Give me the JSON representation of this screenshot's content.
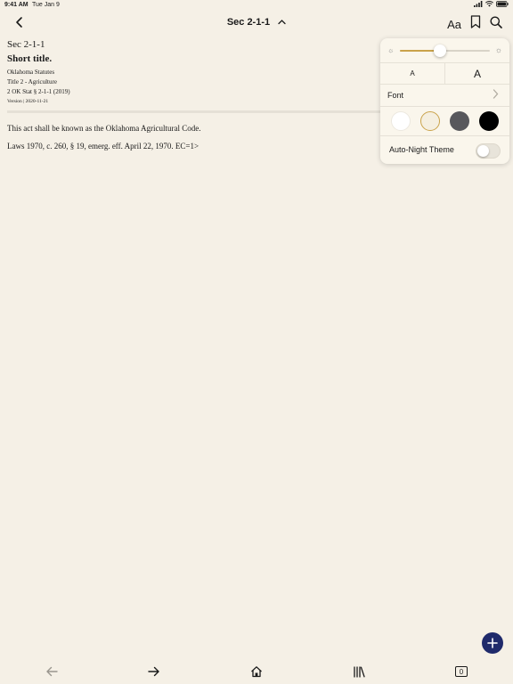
{
  "status_bar": {
    "time": "9:41 AM",
    "date": "Tue Jan 9",
    "icons": [
      "signal-icon",
      "wifi-icon",
      "battery-icon"
    ]
  },
  "nav": {
    "title": "Sec 2-1-1",
    "back_icon": "chevron-left-icon",
    "title_chevron_icon": "chevron-up-icon",
    "text_settings_label": "Aa",
    "bookmark_icon": "bookmark-icon",
    "search_icon": "search-icon"
  },
  "document": {
    "section_label": "Sec 2-1-1",
    "title": "Short title.",
    "meta_source": "Oklahoma Statutes",
    "meta_title": "Title 2 - Agriculture",
    "meta_citation": "2 OK Stat § 2-1-1 (2019)",
    "meta_version": "Version | 2020-11-21",
    "body": "This act shall be known as the Oklahoma Agricultural Code.",
    "history": "Laws 1970, c. 260, § 19, emerg. eff. April 22, 1970. EC=1>"
  },
  "text_settings_popover": {
    "brightness": 0.45,
    "size_small_label": "A",
    "size_large_label": "A",
    "font_label": "Font",
    "themes": [
      {
        "name": "white",
        "color": "#ffffff",
        "selected": false
      },
      {
        "name": "sepia",
        "color": "#f5efe0",
        "selected": true
      },
      {
        "name": "gray",
        "color": "#58585c",
        "selected": false
      },
      {
        "name": "black",
        "color": "#000000",
        "selected": false
      }
    ],
    "auto_night_label": "Auto-Night Theme",
    "auto_night_enabled": false
  },
  "colors": {
    "background": "#f5f0e6",
    "accent": "#c9a24a",
    "fab": "#1f2a6b"
  },
  "fab": {
    "icon": "plus-icon"
  },
  "toolbar": {
    "items": [
      "back-arrow-icon",
      "forward-arrow-icon",
      "home-icon",
      "library-icon",
      "tabs-icon"
    ],
    "tabs_count": "0"
  }
}
